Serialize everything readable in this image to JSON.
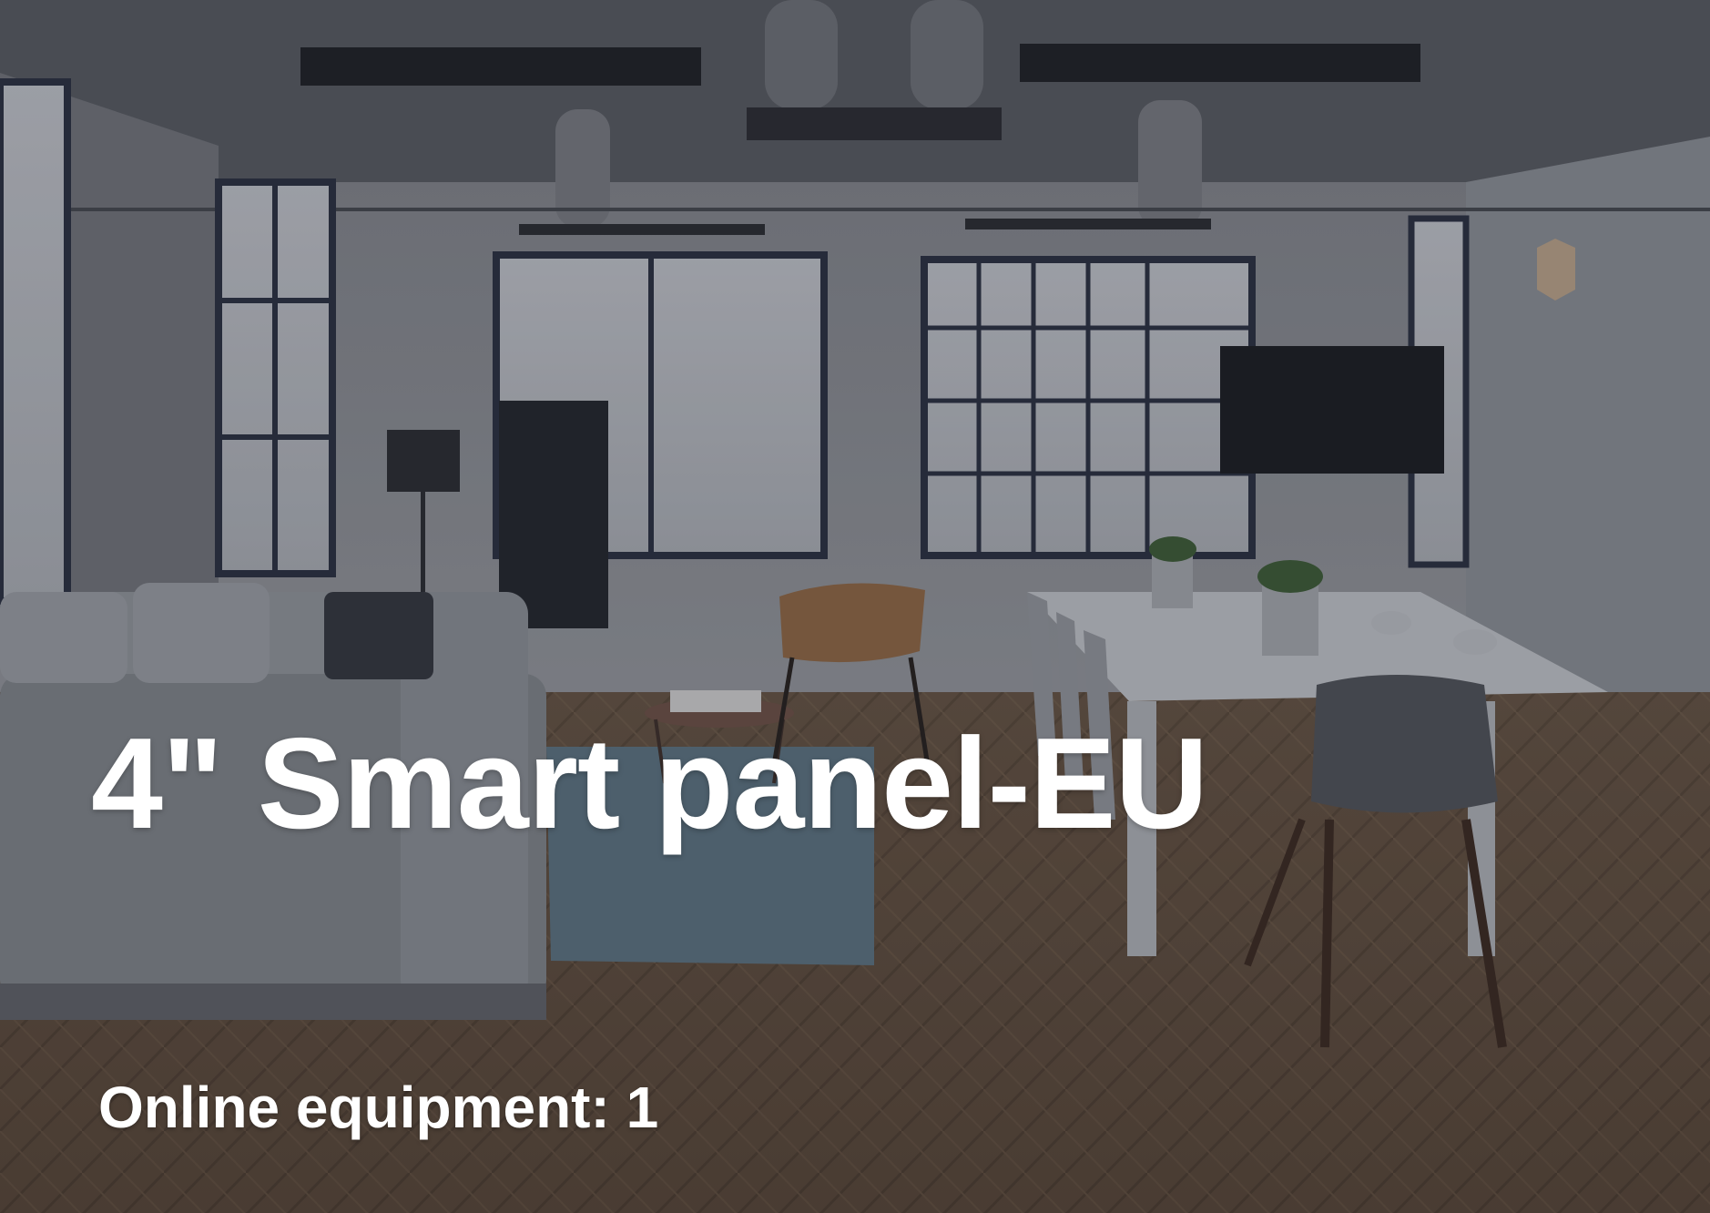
{
  "room_card": {
    "title": "4\" Smart panel-EU",
    "online_label": "Online equipment:",
    "online_count": "1",
    "background_image": "office-interior-photo"
  },
  "colors": {
    "text": "#ffffff",
    "overlay": "#141820"
  }
}
